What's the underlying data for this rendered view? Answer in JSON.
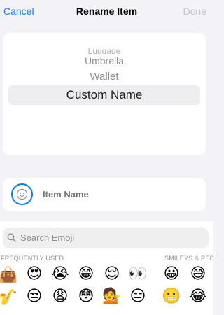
{
  "nav": {
    "cancel": "Cancel",
    "title": "Rename Item",
    "done": "Done"
  },
  "picker": {
    "items": [
      "Luggage",
      "Umbrella",
      "Wallet",
      "Custom Name"
    ],
    "selected": "Custom Name"
  },
  "item": {
    "placeholder": "Item Name"
  },
  "search": {
    "placeholder": "Search Emoji"
  },
  "sections": {
    "frequent": "FREQUENTLY USED",
    "smileys": "SMILEYS & PEOPLE"
  },
  "emoji": {
    "row1": [
      "👜",
      "😍",
      "😭",
      "😁",
      "😌",
      "👀",
      "😀",
      "😅"
    ],
    "row2": [
      "🎷",
      "😒",
      "😩",
      "😳",
      "💁",
      "😑",
      "😬",
      "😂"
    ]
  },
  "colors": {
    "accent": "#0a7aff",
    "background": "#f2f2f7"
  }
}
